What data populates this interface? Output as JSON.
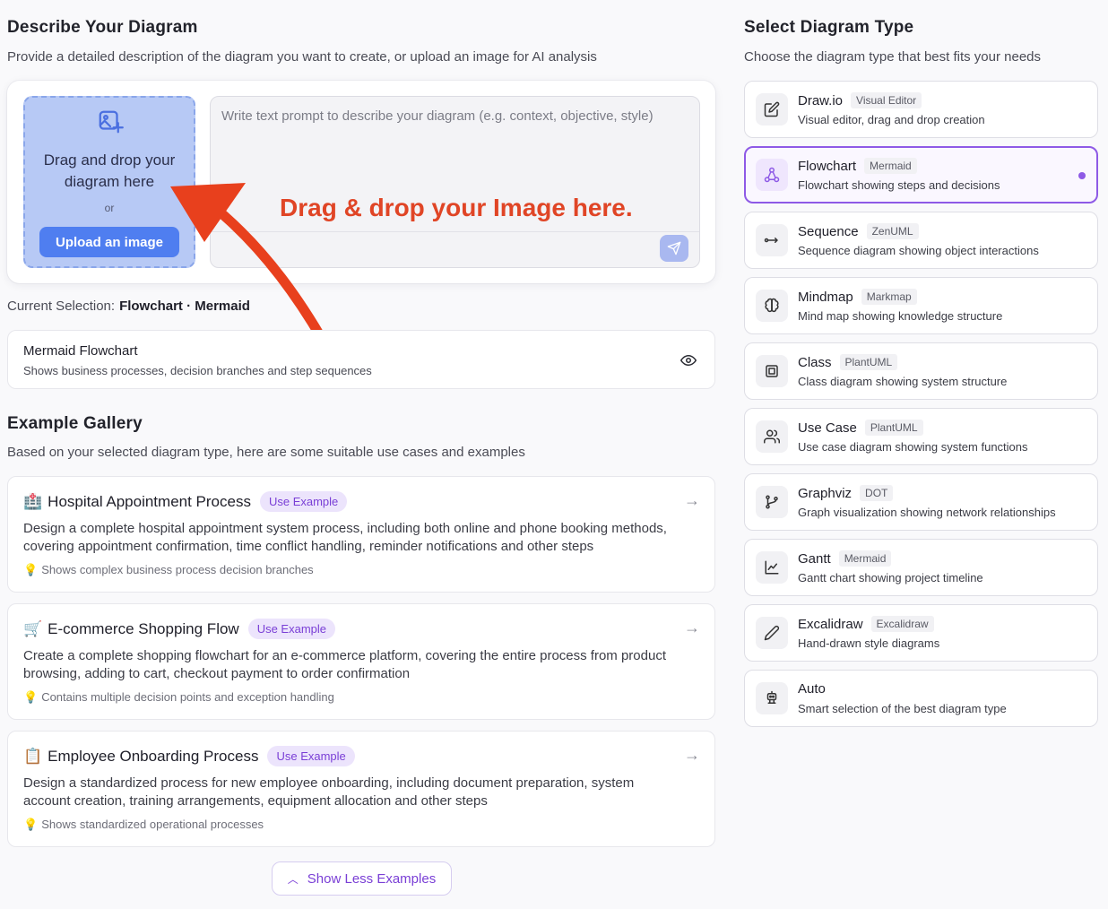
{
  "describe": {
    "title": "Describe Your Diagram",
    "subtitle": "Provide a detailed description of the diagram you want to create, or upload an image for AI analysis",
    "dropzone_text": "Drag and drop your diagram here",
    "or": "or",
    "upload_button": "Upload an image",
    "prompt_placeholder": "Write text prompt to describe your diagram (e.g. context, objective, style)",
    "annotation": "Drag & drop your Image here."
  },
  "current_selection": {
    "label": "Current Selection:",
    "value": "Flowchart · Mermaid"
  },
  "info_card": {
    "title": "Mermaid Flowchart",
    "description": "Shows business processes, decision branches and step sequences"
  },
  "gallery": {
    "title": "Example Gallery",
    "subtitle": "Based on your selected diagram type, here are some suitable use cases and examples",
    "examples": [
      {
        "emoji": "🏥",
        "title": "Hospital Appointment Process",
        "badge": "Use Example",
        "description": "Design a complete hospital appointment system process, including both online and phone booking methods, covering appointment confirmation, time conflict handling, reminder notifications and other steps",
        "tip": "Shows complex business process decision branches"
      },
      {
        "emoji": "🛒",
        "title": "E-commerce Shopping Flow",
        "badge": "Use Example",
        "description": "Create a complete shopping flowchart for an e-commerce platform, covering the entire process from product browsing, adding to cart, checkout payment to order confirmation",
        "tip": "Contains multiple decision points and exception handling"
      },
      {
        "emoji": "📋",
        "title": "Employee Onboarding Process",
        "badge": "Use Example",
        "description": "Design a standardized process for new employee onboarding, including document preparation, system account creation, training arrangements, equipment allocation and other steps",
        "tip": "Shows standardized operational processes"
      }
    ],
    "show_less": "Show Less Examples"
  },
  "types": {
    "title": "Select Diagram Type",
    "subtitle": "Choose the diagram type that best fits your needs",
    "accent_color": "#8e5ae6",
    "items": [
      {
        "name": "Draw.io",
        "tag": "Visual Editor",
        "description": "Visual editor, drag and drop creation",
        "icon": "edit-icon"
      },
      {
        "name": "Flowchart",
        "tag": "Mermaid",
        "description": "Flowchart showing steps and decisions",
        "icon": "flowchart-icon",
        "selected": true
      },
      {
        "name": "Sequence",
        "tag": "ZenUML",
        "description": "Sequence diagram showing object interactions",
        "icon": "sequence-icon"
      },
      {
        "name": "Mindmap",
        "tag": "Markmap",
        "description": "Mind map showing knowledge structure",
        "icon": "brain-icon"
      },
      {
        "name": "Class",
        "tag": "PlantUML",
        "description": "Class diagram showing system structure",
        "icon": "class-icon"
      },
      {
        "name": "Use Case",
        "tag": "PlantUML",
        "description": "Use case diagram showing system functions",
        "icon": "users-icon"
      },
      {
        "name": "Graphviz",
        "tag": "DOT",
        "description": "Graph visualization showing network relationships",
        "icon": "git-branch-icon"
      },
      {
        "name": "Gantt",
        "tag": "Mermaid",
        "description": "Gantt chart showing project timeline",
        "icon": "chart-icon"
      },
      {
        "name": "Excalidraw",
        "tag": "Excalidraw",
        "description": "Hand-drawn style diagrams",
        "icon": "pencil-icon"
      },
      {
        "name": "Auto",
        "tag": "",
        "description": "Smart selection of the best diagram type",
        "icon": "robot-icon"
      }
    ]
  }
}
